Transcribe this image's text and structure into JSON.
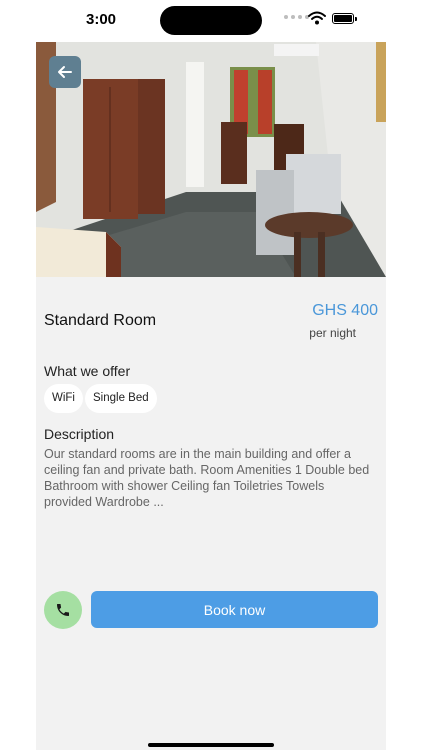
{
  "status_bar": {
    "time": "3:00"
  },
  "room": {
    "name": "Standard Room",
    "price": "GHS 400",
    "price_unit": "per night"
  },
  "offer": {
    "heading": "What we offer",
    "amenities": [
      "WiFi",
      "Single Bed"
    ]
  },
  "description": {
    "heading": "Description",
    "text": "Our standard rooms are in the main building and offer a ceiling fan and private bath. Room Amenities 1 Double bed Bathroom with shower Ceiling fan Toiletries Towels provided Wardrobe ..."
  },
  "actions": {
    "book_label": "Book now",
    "call_icon": "phone-icon",
    "back_icon": "arrow-left-icon"
  },
  "colors": {
    "accent": "#4d9de5",
    "price": "#4a97d9",
    "call_bg": "#a5dfa2",
    "back_bg": "#5f7f91"
  }
}
